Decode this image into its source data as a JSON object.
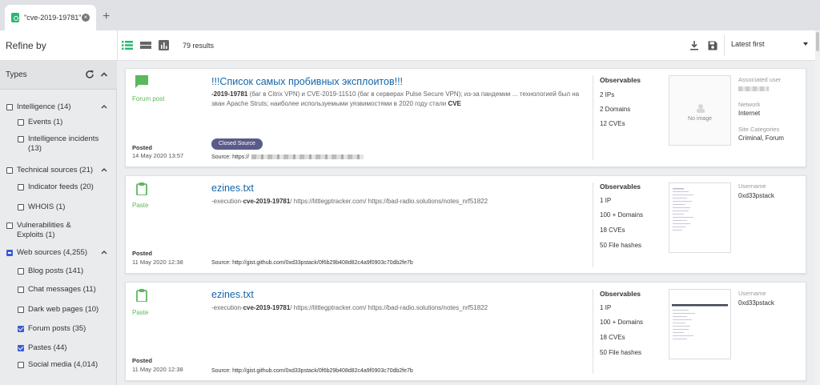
{
  "browser": {
    "tab_title": "\"cve-2019-19781\"",
    "new_tab": "+"
  },
  "toolbar": {
    "refine_title": "Refine by",
    "results_count": "79 results",
    "sort_value": "Latest first"
  },
  "sidebar": {
    "types_label": "Types",
    "groups": [
      {
        "label": "Intelligence (14)",
        "state": "unchecked",
        "children": [
          {
            "label": "Events (1)",
            "checked": false
          },
          {
            "label": "Intelligence incidents (13)",
            "checked": false
          }
        ]
      },
      {
        "label": "Technical sources (21)",
        "state": "unchecked",
        "children": [
          {
            "label": "Indicator feeds (20)",
            "checked": false
          },
          {
            "label": "WHOIS (1)",
            "checked": false
          }
        ]
      },
      {
        "label": "Vulnerabilities & Exploits (1)",
        "state": "unchecked",
        "children": []
      },
      {
        "label": "Web sources (4,255)",
        "state": "partial",
        "children": [
          {
            "label": "Blog posts (141)",
            "checked": false
          },
          {
            "label": "Chat messages (11)",
            "checked": false
          },
          {
            "label": "Dark web pages (10)",
            "checked": false
          },
          {
            "label": "Forum posts (35)",
            "checked": true
          },
          {
            "label": "Pastes (44)",
            "checked": true
          },
          {
            "label": "Social media (4,014)",
            "checked": false
          }
        ]
      }
    ]
  },
  "results": [
    {
      "type_label": "Forum post",
      "posted_label": "Posted",
      "posted_date": "14 May 2020 13:57",
      "title": "!!!Список самых пробивных эксплоитов!!!",
      "snippet_bold_1": "-2019-19781",
      "snippet_1": " (баг в Citrix VPN) и CVE-2019-11510 (баг в серверах Pulse Secure VPN); из-за пандемии ... технологией был на зван Apache Struts; наиболее используемыми уязвимостями в 2020 году стали ",
      "snippet_bold_2": "CVE",
      "badge": "Closed Source",
      "source": "Source: https://",
      "observables_title": "Observables",
      "observables": [
        "2 IPs",
        "2 Domains",
        "12 CVEs"
      ],
      "thumb_text": "No image",
      "meta": [
        {
          "label": "Associated user",
          "value": ""
        },
        {
          "label": "Network",
          "value": "Internet"
        },
        {
          "label": "Site Categories",
          "value": "Criminal, Forum"
        }
      ]
    },
    {
      "type_label": "Paste",
      "posted_label": "Posted",
      "posted_date": "11 May 2020 12:38",
      "title": "ezines.txt",
      "snippet_pre": "-execution-",
      "snippet_bold": "cve-2019-19781",
      "snippet_post": "/ https://littlegptracker.com/ https://bad-radio.solutions/notes_nrf51822",
      "source": "Source: http://gist.github.com/0xd33pstack/0f6b29b408d82c4a9f0903c70db2fe7b",
      "observables_title": "Observables",
      "observables": [
        "1 IP",
        "100 + Domains",
        "18 CVEs",
        "50 File hashes"
      ],
      "meta": [
        {
          "label": "Username",
          "value": "0xd33pstack"
        }
      ]
    },
    {
      "type_label": "Paste",
      "posted_label": "Posted",
      "posted_date": "11 May 2020 12:38",
      "title": "ezines.txt",
      "snippet_pre": "-execution-",
      "snippet_bold": "cve-2019-19781",
      "snippet_post": "/ https://littlegptracker.com/ https://bad-radio.solutions/notes_nrf51822",
      "source": "Source: http://gist.github.com/0xd33pstack/0f6b29b408d82c4a9f0903c70db2fe7b",
      "observables_title": "Observables",
      "observables": [
        "1 IP",
        "100 + Domains",
        "18 CVEs",
        "50 File hashes"
      ],
      "meta": [
        {
          "label": "Username",
          "value": "0xd33pstack"
        }
      ]
    }
  ],
  "colors": {
    "accent_green": "#5cb85c",
    "title_blue": "#1565a8",
    "checkbox_blue": "#3b5bd6",
    "badge_purple": "#5a5b8b"
  }
}
